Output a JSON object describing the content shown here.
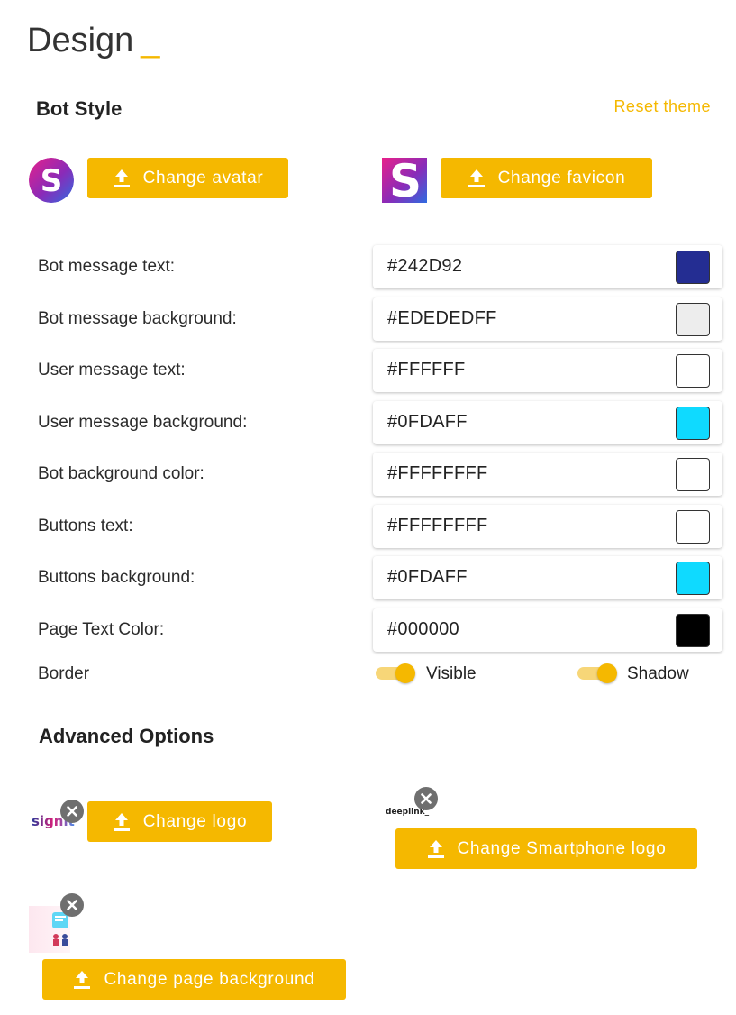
{
  "page": {
    "title": "Design",
    "title_accent": "_"
  },
  "bot_style": {
    "heading": "Bot Style",
    "reset_label": "Reset theme",
    "avatar_button": "Change avatar",
    "favicon_button": "Change favicon"
  },
  "colors": [
    {
      "label": "Bot message text:",
      "value": "#242D92",
      "swatch": "#242D92"
    },
    {
      "label": "Bot message background:",
      "value": "#EDEDEDFF",
      "swatch": "#EDEDED"
    },
    {
      "label": "User message text:",
      "value": "#FFFFFF",
      "swatch": "#FFFFFF"
    },
    {
      "label": "User message background:",
      "value": "#0FDAFF",
      "swatch": "#0FDAFF"
    },
    {
      "label": "Bot background color:",
      "value": "#FFFFFFFF",
      "swatch": "#FFFFFF"
    },
    {
      "label": "Buttons text:",
      "value": "#FFFFFFFF",
      "swatch": "#FFFFFF"
    },
    {
      "label": "Buttons background:",
      "value": "#0FDAFF",
      "swatch": "#0FDAFF"
    },
    {
      "label": "Page Text Color:",
      "value": "#000000",
      "swatch": "#000000"
    }
  ],
  "border": {
    "label": "Border",
    "visible_label": "Visible",
    "visible_on": true,
    "shadow_label": "Shadow",
    "shadow_on": true
  },
  "advanced": {
    "heading": "Advanced Options",
    "logo_text": "signit",
    "logo_button": "Change logo",
    "smartphone_logo_text": "deeplink_",
    "smartphone_logo_button": "Change Smartphone logo",
    "page_background_button": "Change page background"
  },
  "theme": {
    "accent": "#f5b800"
  }
}
